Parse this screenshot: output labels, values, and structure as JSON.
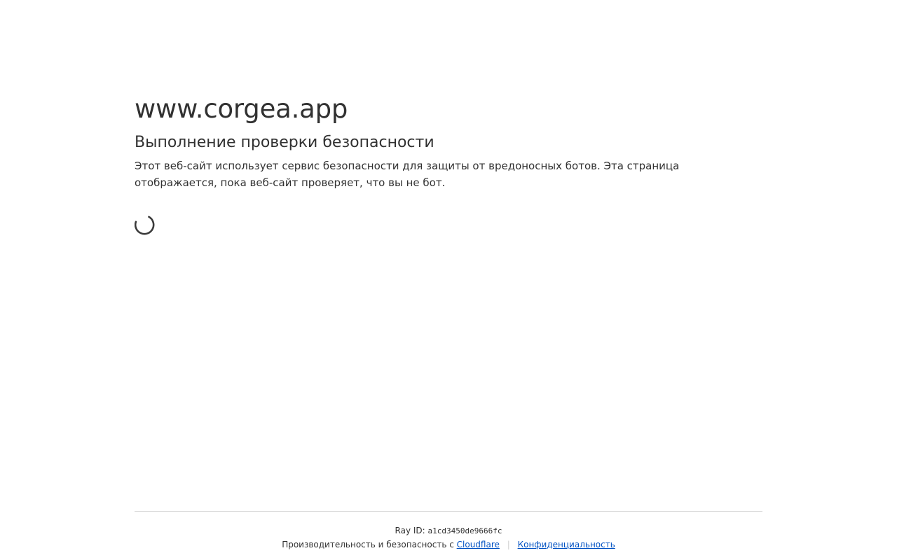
{
  "site": {
    "name": "www.corgea.app"
  },
  "challenge": {
    "headline": "Выполнение проверки безопасности",
    "description": "Этот веб-сайт использует сервис безопасности для защиты от вредоносных ботов. Эта страница отображается, пока веб-сайт проверяет, что вы не бот.",
    "spinner_icon": "loading-spinner-icon"
  },
  "footer": {
    "ray_label": "Ray ID:",
    "ray_id": "a1cd3450de9666fc",
    "credits_text": "Производительность и безопасность с",
    "cloudflare_link": "Cloudflare",
    "separator": "|",
    "privacy_link": "Конфиденциальность"
  },
  "colors": {
    "text": "#313131",
    "link": "#0051c3",
    "divider": "#d9d9d9",
    "background": "#ffffff"
  }
}
